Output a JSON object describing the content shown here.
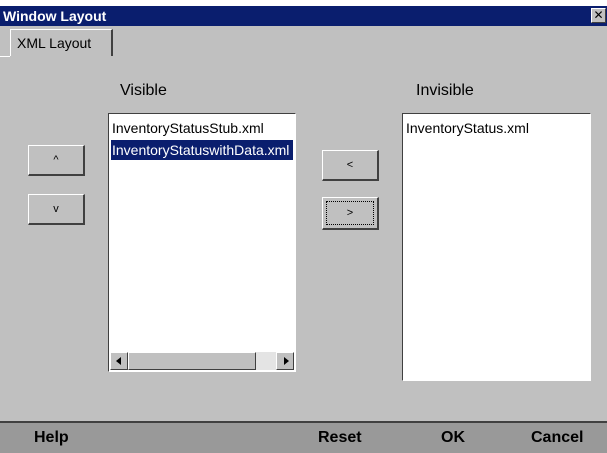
{
  "window": {
    "title": "Window Layout",
    "close_glyph": "✕"
  },
  "tabs": [
    {
      "label": "XML Layout"
    }
  ],
  "visible": {
    "label": "Visible",
    "items": [
      "InventoryStatusStub.xml",
      "InventoryStatuswithData.xml"
    ],
    "selected_index": 1
  },
  "invisible": {
    "label": "Invisible",
    "items": [
      "InventoryStatus.xml"
    ]
  },
  "order_buttons": {
    "up_label": "^",
    "down_label": "v"
  },
  "move_buttons": {
    "to_visible_label": "<",
    "to_invisible_label": ">"
  },
  "footer": {
    "help_label": "Help",
    "reset_label": "Reset",
    "ok_label": "OK",
    "cancel_label": "Cancel"
  },
  "colors": {
    "title_bg": "#0a1e6e",
    "selection_bg": "#0a1e6e",
    "dialog_bg": "#c0c0c0",
    "footer_bg": "#999999"
  },
  "icons": {
    "close": "close-icon",
    "scroll_left": "arrow-left-icon",
    "scroll_right": "arrow-right-icon"
  }
}
